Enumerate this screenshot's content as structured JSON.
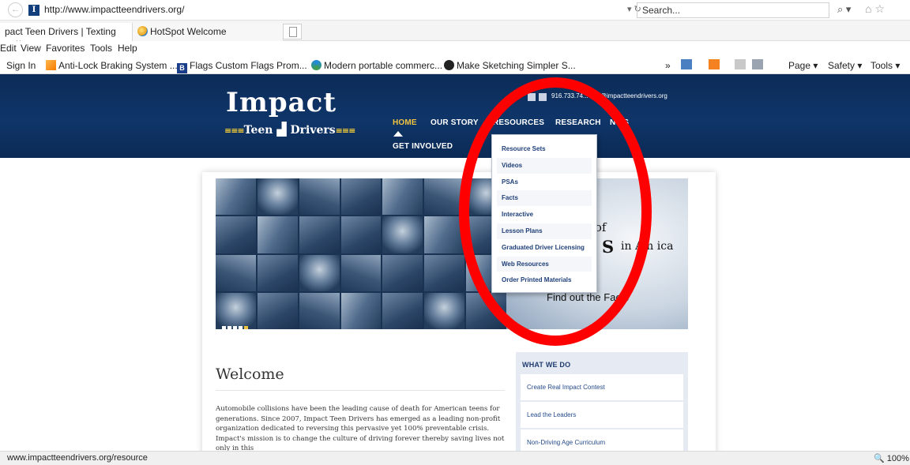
{
  "browser": {
    "url": "http://www.impactteendrivers.org/",
    "search_placeholder": "Search...",
    "tabs": [
      {
        "label": "pact Teen Drivers | Texting ..."
      },
      {
        "label": "HotSpot Welcome"
      }
    ],
    "menu": [
      "Edit",
      "View",
      "Favorites",
      "Tools",
      "Help"
    ],
    "favorites": [
      "Sign In",
      "Anti-Lock Braking System ...",
      "Flags  Custom Flags  Prom...",
      "Modern portable commerc...",
      "Make Sketching Simpler  S..."
    ],
    "commands": {
      "chevron": "»",
      "page": "Page ▾",
      "safety": "Safety ▾",
      "tools": "Tools ▾"
    },
    "status_url": "www.impactteendrivers.org/resource",
    "zoom": "100%"
  },
  "site": {
    "logo_main": "Impact",
    "logo_sub_left": "Teen",
    "logo_sub_right": "Drivers",
    "contact": "916.733.74...  info@impactteendrivers.org",
    "nav": {
      "home": "HOME",
      "our_story": "OUR STORY",
      "resources": "RESOURCES",
      "research": "RESEARCH",
      "news": "N  VS",
      "get_involved": "GET INVOLVED"
    },
    "resources_menu": [
      "Resource Sets",
      "Videos",
      "PSAs",
      "Facts",
      "Interactive",
      "Lesson Plans",
      "Graduated Driver Licensing",
      "Web Resources",
      "Order Printed Materials"
    ],
    "slide": {
      "line1": "er of",
      "big": "S",
      "line2": "in Am   ica",
      "cta": "Find out the Facts"
    },
    "welcome": {
      "title": "Welcome",
      "body": "Automobile collisions have been the leading cause of death for American teens for generations. Since 2007, Impact Teen Drivers has emerged as a leading non-profit organization dedicated to reversing this pervasive yet 100% preventable crisis. Impact's mission is to change the culture of driving forever thereby saving lives not only in this"
    },
    "what_we_do": {
      "title": "WHAT WE DO",
      "items": [
        "Create Real Impact Contest",
        "Lead the Leaders",
        "Non-Driving Age Curriculum"
      ]
    }
  }
}
